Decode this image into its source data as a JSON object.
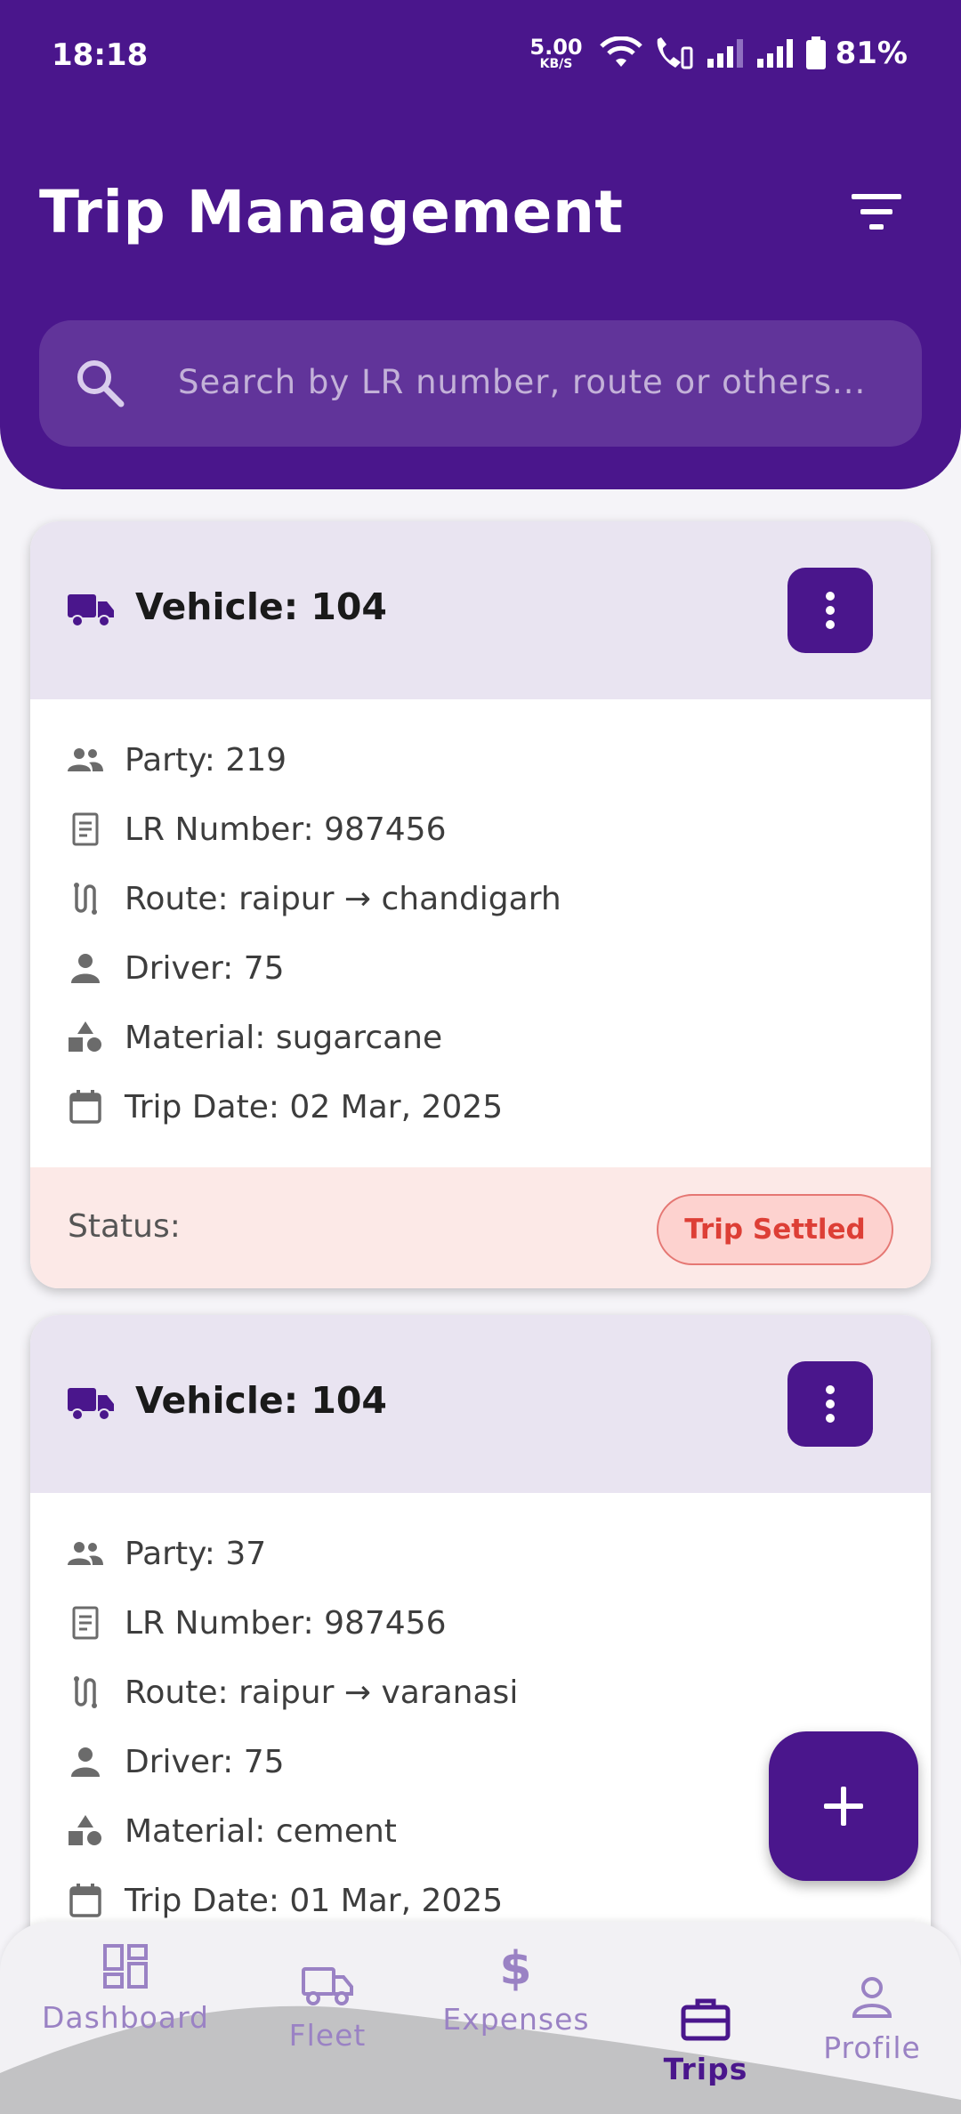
{
  "status_bar": {
    "time": "18:18",
    "speed_value": "5.00",
    "speed_unit": "KB/S",
    "battery": "81%"
  },
  "header": {
    "title": "Trip Management",
    "filter_icon": "filter-icon"
  },
  "search": {
    "placeholder": "Search by LR number, route or others..."
  },
  "trips": [
    {
      "vehicle": "Vehicle: 104",
      "party": "Party: 219",
      "lr_number": "LR Number: 987456",
      "route": "Route: raipur  → chandigarh",
      "driver": "Driver: 75",
      "material": "Material: sugarcane",
      "trip_date": "Trip Date: 02 Mar, 2025",
      "status_label": "Status:",
      "status": "Trip Settled"
    },
    {
      "vehicle": "Vehicle: 104",
      "party": "Party: 37",
      "lr_number": "LR Number: 987456",
      "route": "Route: raipur  → varanasi",
      "driver": "Driver: 75",
      "material": "Material: cement",
      "trip_date": "Trip Date: 01 Mar, 2025"
    }
  ],
  "nav": {
    "items": [
      {
        "label": "Dashboard",
        "icon": "dashboard-icon"
      },
      {
        "label": "Fleet",
        "icon": "truck-icon"
      },
      {
        "label": "Expenses",
        "icon": "dollar-icon"
      },
      {
        "label": "Trips",
        "icon": "briefcase-icon",
        "active": true
      },
      {
        "label": "Profile",
        "icon": "person-icon"
      }
    ]
  },
  "colors": {
    "primary": "#4a168c",
    "status_bg": "#fce9e7",
    "status_text": "#dd3f36",
    "card_header": "#e9e4f1"
  }
}
